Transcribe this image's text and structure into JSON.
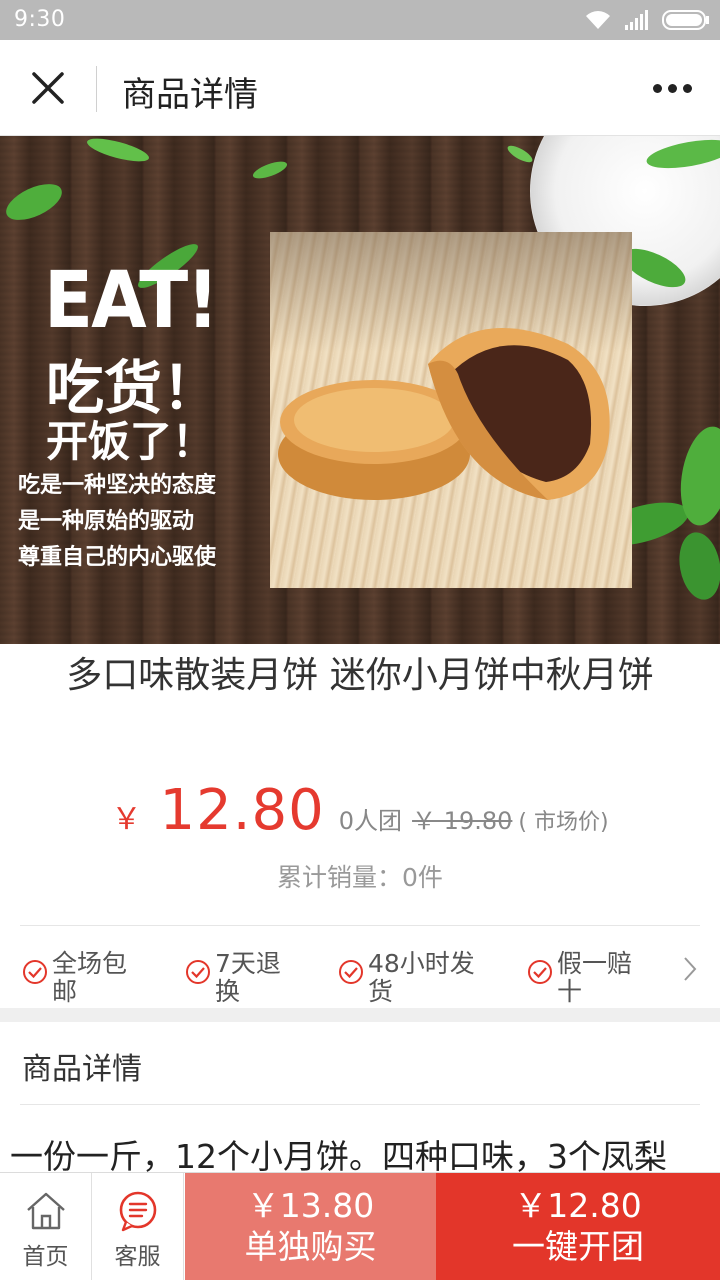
{
  "status_bar": {
    "time": "9:30",
    "icons": [
      "wifi-icon",
      "signal-icon",
      "battery-icon"
    ]
  },
  "nav": {
    "title": "商品详情",
    "close_icon": "close-icon",
    "more_icon": "more-icon"
  },
  "banner": {
    "headline": "EAT!",
    "line1": "吃货！",
    "line2": "开饭了！",
    "slogan": [
      "吃是一种坚决的态度",
      "是一种原始的驱动",
      "尊重自己的内心驱使"
    ]
  },
  "product": {
    "title": "多口味散装月饼 迷你小月饼中秋月饼",
    "currency": "￥",
    "price": "12.80",
    "group_text": "0人团",
    "market_price": "￥ 19.80",
    "market_note": "( 市场价)",
    "sales": "累计销量：0件"
  },
  "services": [
    {
      "label": "全场包邮"
    },
    {
      "label": "7天退换"
    },
    {
      "label": "48小时发货"
    },
    {
      "label": "假一赔十"
    }
  ],
  "detail": {
    "title": "商品详情",
    "text": "一份一斤，12个小月饼。四种口味，3个凤梨"
  },
  "bottom_bar": {
    "home": {
      "label": "首页",
      "icon": "home-icon"
    },
    "service": {
      "label": "客服",
      "icon": "chat-icon"
    },
    "solo": {
      "price": "￥13.80",
      "label": "单独购买"
    },
    "group": {
      "price": "￥12.80",
      "label": "一键开团"
    }
  },
  "colors": {
    "accent": "#e3362a",
    "solo_button": "#e8796f",
    "status_bar": "#b9b9b9"
  }
}
